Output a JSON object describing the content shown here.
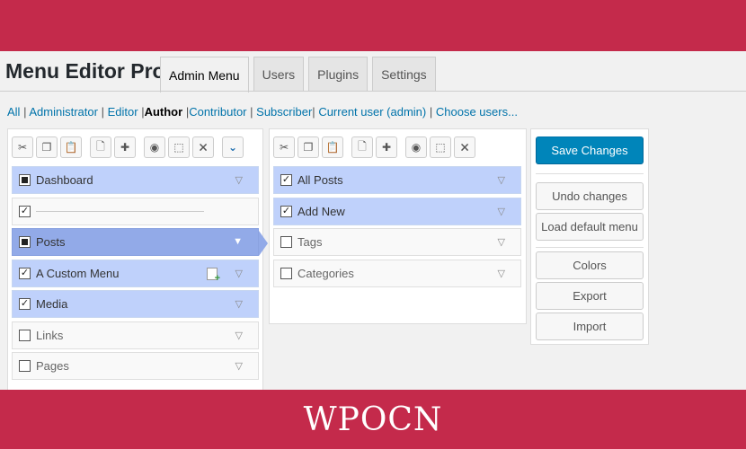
{
  "brand": {
    "name": "WPOCN"
  },
  "header": {
    "title": "Menu Editor Pro",
    "tabs": [
      {
        "label": "Admin Menu",
        "active": true
      },
      {
        "label": "Users"
      },
      {
        "label": "Plugins"
      },
      {
        "label": "Settings"
      }
    ]
  },
  "roles": {
    "all": "All",
    "administrator": "Administrator",
    "editor": "Editor",
    "author": "Author",
    "contributor": "Contributor",
    "subscriber": "Subscriber",
    "current_user": "Current user (admin)",
    "choose_users": "Choose users...",
    "separator": "|"
  },
  "left_panel": {
    "toolbar_icons": [
      "cut-icon",
      "copy-icon",
      "paste-icon",
      "new-menu-icon",
      "new-separator-icon",
      "hide-icon",
      "select-icon",
      "delete-icon",
      "expand-icon"
    ],
    "items": [
      {
        "label": "Dashboard",
        "checked": "partial"
      },
      {
        "label": "",
        "type": "separator",
        "checked": true
      },
      {
        "label": "Posts",
        "checked": "partial",
        "selected": true
      },
      {
        "label": "A Custom Menu",
        "checked": true
      },
      {
        "label": "Media",
        "checked": true
      },
      {
        "label": "Links",
        "checked": false
      },
      {
        "label": "Pages",
        "checked": false
      }
    ]
  },
  "right_panel": {
    "toolbar_icons": [
      "cut-icon",
      "copy-icon",
      "paste-icon",
      "new-menu-icon",
      "new-separator-icon",
      "hide-icon",
      "select-icon",
      "delete-icon"
    ],
    "items": [
      {
        "label": "All Posts",
        "checked": true
      },
      {
        "label": "Add New",
        "checked": true
      },
      {
        "label": "Tags",
        "checked": false
      },
      {
        "label": "Categories",
        "checked": false
      }
    ]
  },
  "actions": {
    "save": "Save Changes",
    "undo": "Undo changes",
    "load_default": "Load default menu",
    "colors": "Colors",
    "export": "Export",
    "import": "Import"
  },
  "colors": {
    "band": "#c42a4b",
    "item_bg": "#bfd1fb",
    "item_selected": "#92aae8",
    "primary_button": "#0085ba"
  }
}
